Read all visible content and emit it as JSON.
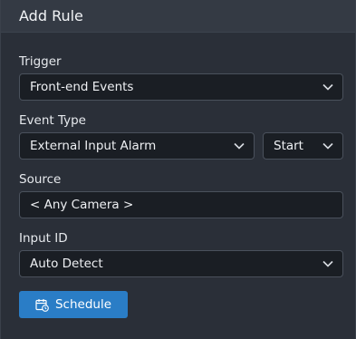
{
  "header": {
    "title": "Add Rule"
  },
  "trigger": {
    "label": "Trigger",
    "value": "Front-end Events"
  },
  "event_type": {
    "label": "Event Type",
    "value": "External Input Alarm",
    "state_value": "Start"
  },
  "source": {
    "label": "Source",
    "value": "< Any Camera >"
  },
  "input_id": {
    "label": "Input ID",
    "value": "Auto Detect"
  },
  "schedule": {
    "label": "Schedule",
    "icon": "calendar-clock-icon"
  },
  "colors": {
    "accent": "#2a7dc6",
    "background": "#2a2f38",
    "field_bg": "#1a1e24"
  }
}
